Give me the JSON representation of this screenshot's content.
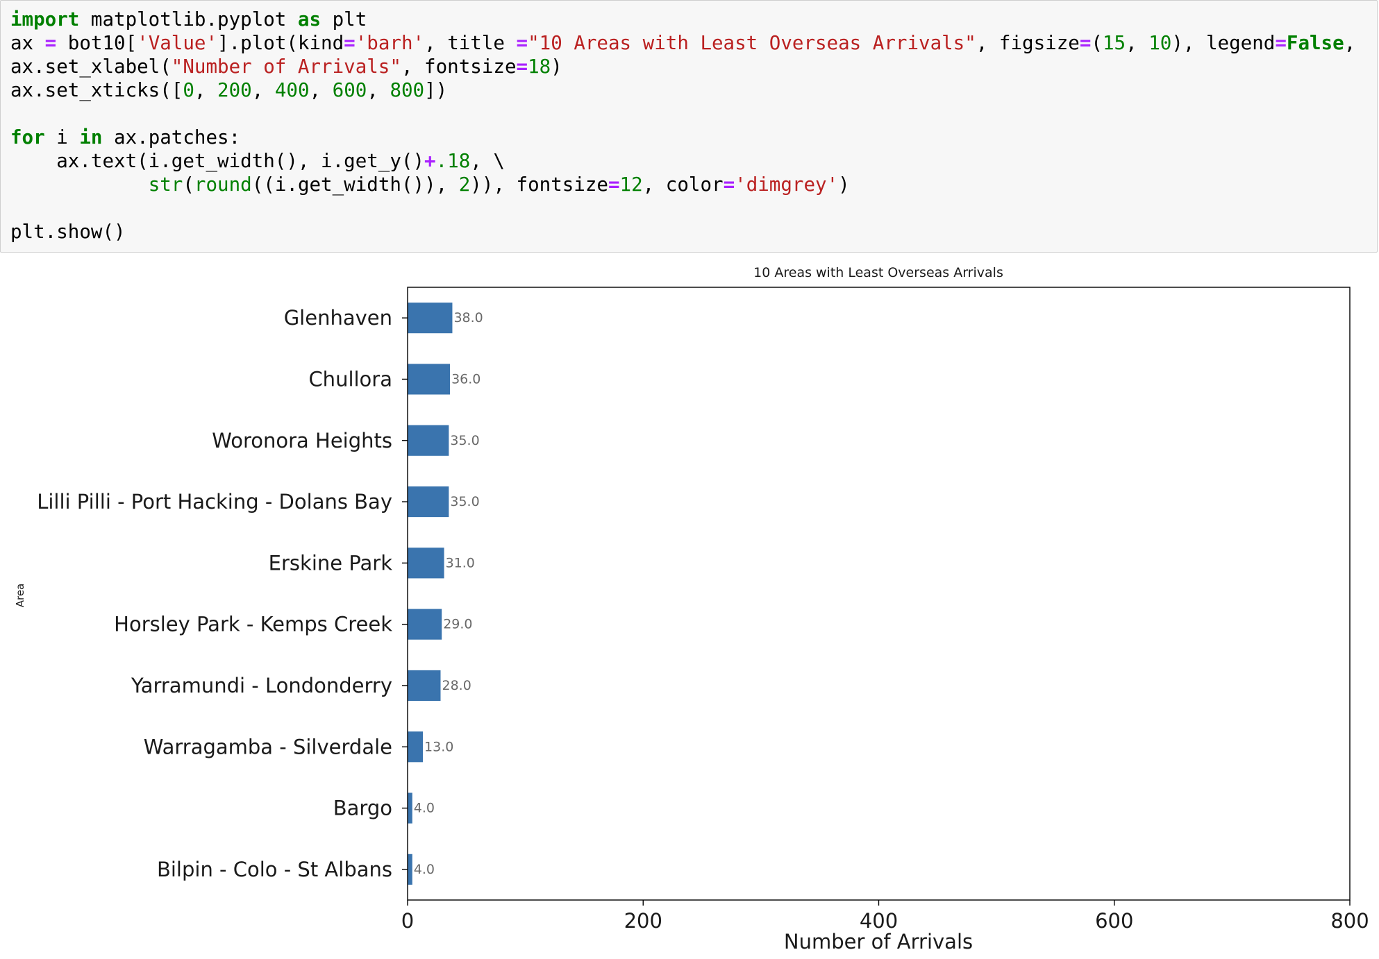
{
  "code_cell": {
    "lines": [
      [
        [
          "k",
          "import"
        ],
        [
          "t",
          " matplotlib.pyplot "
        ],
        [
          "k",
          "as"
        ],
        [
          "t",
          " plt"
        ]
      ],
      [
        [
          "t",
          "ax "
        ],
        [
          "op",
          "="
        ],
        [
          "t",
          " bot10["
        ],
        [
          "s",
          "'Value'"
        ],
        [
          "t",
          "].plot(kind"
        ],
        [
          "op",
          "="
        ],
        [
          "s",
          "'barh'"
        ],
        [
          "t",
          ", title "
        ],
        [
          "op",
          "="
        ],
        [
          "s",
          "\"10 Areas with Least Overseas Arrivals\""
        ],
        [
          "t",
          ", figsize"
        ],
        [
          "op",
          "="
        ],
        [
          "t",
          "("
        ],
        [
          "n",
          "15"
        ],
        [
          "t",
          ", "
        ],
        [
          "n",
          "10"
        ],
        [
          "t",
          "), legend"
        ],
        [
          "op",
          "="
        ],
        [
          "k",
          "False"
        ],
        [
          "t",
          ","
        ]
      ],
      [
        [
          "t",
          "ax.set_xlabel("
        ],
        [
          "s",
          "\"Number of Arrivals\""
        ],
        [
          "t",
          ", fontsize"
        ],
        [
          "op",
          "="
        ],
        [
          "n",
          "18"
        ],
        [
          "t",
          ")"
        ]
      ],
      [
        [
          "t",
          "ax.set_xticks(["
        ],
        [
          "n",
          "0"
        ],
        [
          "t",
          ", "
        ],
        [
          "n",
          "200"
        ],
        [
          "t",
          ", "
        ],
        [
          "n",
          "400"
        ],
        [
          "t",
          ", "
        ],
        [
          "n",
          "600"
        ],
        [
          "t",
          ", "
        ],
        [
          "n",
          "800"
        ],
        [
          "t",
          "])"
        ]
      ],
      [],
      [
        [
          "k",
          "for"
        ],
        [
          "t",
          " i "
        ],
        [
          "k",
          "in"
        ],
        [
          "t",
          " ax.patches:"
        ]
      ],
      [
        [
          "t",
          "    ax.text(i.get_width(), i.get_y()"
        ],
        [
          "op",
          "+"
        ],
        [
          "n",
          ".18"
        ],
        [
          "t",
          ", \\"
        ]
      ],
      [
        [
          "t",
          "            "
        ],
        [
          "bi",
          "str"
        ],
        [
          "t",
          "("
        ],
        [
          "bi",
          "round"
        ],
        [
          "t",
          "((i.get_width()), "
        ],
        [
          "n",
          "2"
        ],
        [
          "t",
          ")), fontsize"
        ],
        [
          "op",
          "="
        ],
        [
          "n",
          "12"
        ],
        [
          "t",
          ", color"
        ],
        [
          "op",
          "="
        ],
        [
          "s",
          "'dimgrey'"
        ],
        [
          "t",
          ")"
        ]
      ],
      [],
      [
        [
          "t",
          "plt.show()"
        ]
      ]
    ]
  },
  "colors": {
    "bar": "#3a74ae",
    "value_label": "#696969",
    "text": "#1a1a1a",
    "code_bg": "#f7f7f7"
  },
  "chart_data": {
    "type": "bar",
    "orientation": "horizontal",
    "title": "10 Areas with Least Overseas Arrivals",
    "xlabel": "Number of Arrivals",
    "ylabel": "Area",
    "categories": [
      "Glenhaven",
      "Chullora",
      "Woronora Heights",
      "Lilli Pilli - Port Hacking - Dolans Bay",
      "Erskine Park",
      "Horsley Park - Kemps Creek",
      "Yarramundi - Londonderry",
      "Warragamba - Silverdale",
      "Bargo",
      "Bilpin - Colo - St Albans"
    ],
    "values": [
      38,
      36,
      35,
      35,
      31,
      29,
      28,
      13,
      4,
      4
    ],
    "value_labels": [
      "38.0",
      "36.0",
      "35.0",
      "35.0",
      "31.0",
      "29.0",
      "28.0",
      "13.0",
      "4.0",
      "4.0"
    ],
    "xticks": [
      0,
      200,
      400,
      600,
      800
    ],
    "xtick_labels": [
      "0",
      "200",
      "400",
      "600",
      "800"
    ],
    "xlim": [
      0,
      800
    ],
    "grid": false,
    "legend": false
  }
}
